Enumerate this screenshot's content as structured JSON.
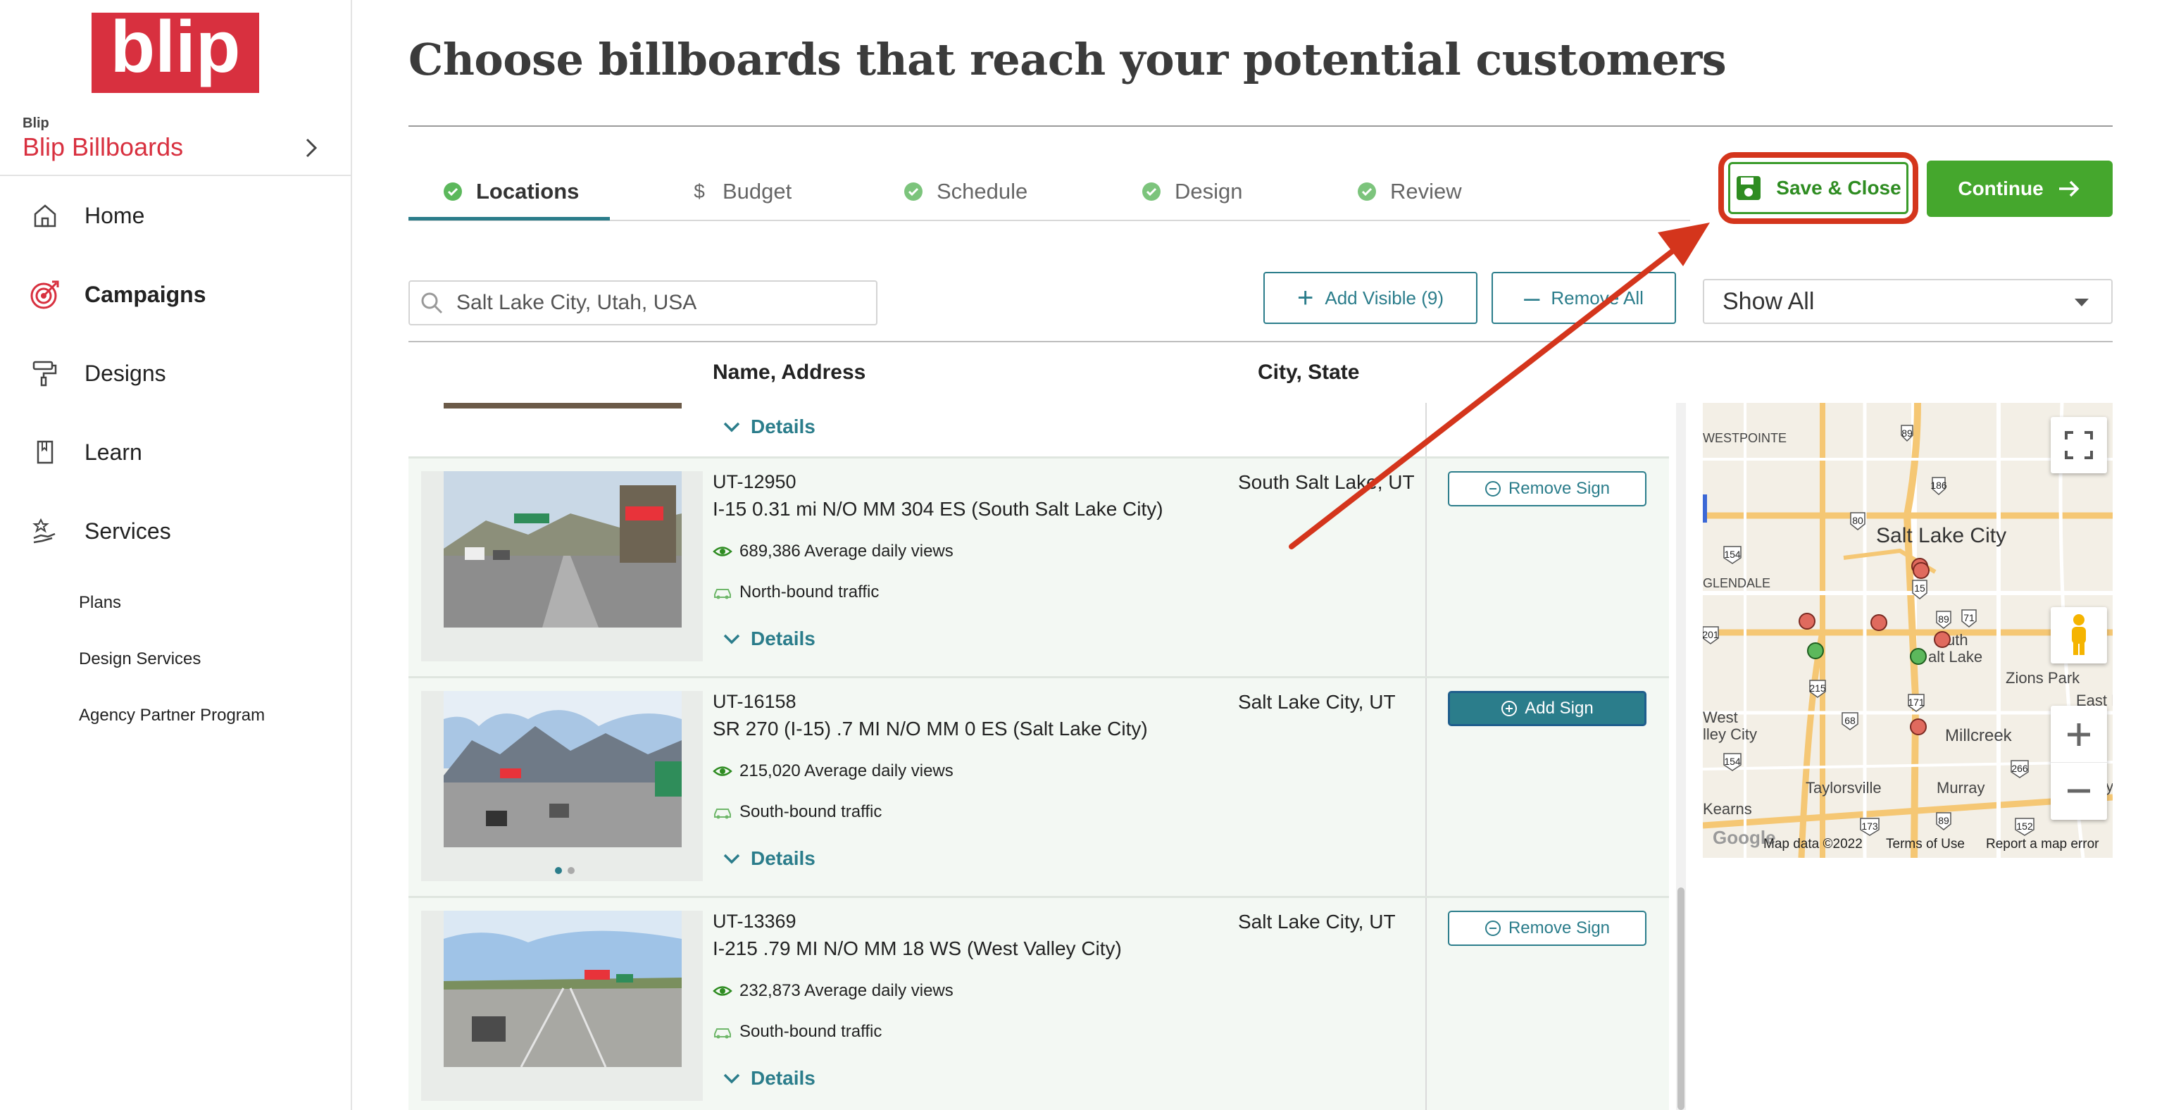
{
  "sidebar": {
    "brand": "blip",
    "account_small": "Blip",
    "account_name": "Blip Billboards",
    "nav": [
      {
        "label": "Home",
        "icon": "home-icon"
      },
      {
        "label": "Campaigns",
        "icon": "target-icon",
        "active": true
      },
      {
        "label": "Designs",
        "icon": "paint-roller-icon"
      },
      {
        "label": "Learn",
        "icon": "bookmark-icon"
      },
      {
        "label": "Services",
        "icon": "hand-service-icon"
      }
    ],
    "sub_items": [
      "Plans",
      "Design Services",
      "Agency Partner Program"
    ]
  },
  "page": {
    "title": "Choose billboards that reach your potential customers"
  },
  "tabs": [
    {
      "label": "Locations",
      "icon": "check-circle-icon",
      "active": true
    },
    {
      "label": "Budget",
      "icon": "dollar-icon"
    },
    {
      "label": "Schedule",
      "icon": "check-circle-icon"
    },
    {
      "label": "Design",
      "icon": "check-circle-icon"
    },
    {
      "label": "Review",
      "icon": "check-circle-icon"
    }
  ],
  "actions": {
    "save_close": "Save & Close",
    "continue": "Continue"
  },
  "filters": {
    "search_value": "Salt Lake City, Utah, USA",
    "add_visible": "Add Visible (9)",
    "remove_all": "Remove All",
    "show_select": "Show All"
  },
  "table": {
    "headers": {
      "name": "Name, Address",
      "city": "City, State"
    },
    "details_label": "Details",
    "rows": [
      {
        "code": "UT-12950",
        "address": "I-15 0.31 mi N/O MM 304 ES (South Salt Lake City)",
        "views": "689,386 Average daily views",
        "traffic": "North-bound traffic",
        "city": "South Salt Lake, UT",
        "action": "Remove Sign"
      },
      {
        "code": "UT-16158",
        "address": "SR 270 (I-15) .7 MI N/O MM 0 ES (Salt Lake City)",
        "views": "215,020 Average daily views",
        "traffic": "South-bound traffic",
        "city": "Salt Lake City, UT",
        "action": "Add Sign"
      },
      {
        "code": "UT-13369",
        "address": "I-215 .79 MI N/O MM 18 WS (West Valley City)",
        "views": "232,873 Average daily views",
        "traffic": "South-bound traffic",
        "city": "Salt Lake City, UT",
        "action": "Remove Sign"
      }
    ]
  },
  "map": {
    "labels": {
      "westpointe": "WESTPOINTE",
      "salt_lake_city": "Salt Lake City",
      "glendale": "GLENDALE",
      "south_salt_lake_1": "uth",
      "south_salt_lake_2": "alt Lake",
      "zions_park": "Zions Park",
      "east_mi": "East Mi",
      "west_valley_1": "West",
      "west_valley_2": "lley City",
      "millcreek": "Millcreek",
      "taylorsville": "Taylorsville",
      "murray": "Murray",
      "kearns": "Kearns",
      "ay": "ay"
    },
    "shields": [
      "89",
      "186",
      "80",
      "154",
      "15",
      "89",
      "71",
      "201",
      "215",
      "68",
      "171",
      "266",
      "154",
      "173",
      "89",
      "152"
    ],
    "footer": {
      "data": "Map data ©2022",
      "terms": "Terms of Use",
      "report": "Report a map error",
      "google": "Google"
    }
  },
  "colors": {
    "brand_red": "#d8303f",
    "teal": "#2b7d8b",
    "green": "#45a72d",
    "annotation_red": "#d4351c"
  }
}
